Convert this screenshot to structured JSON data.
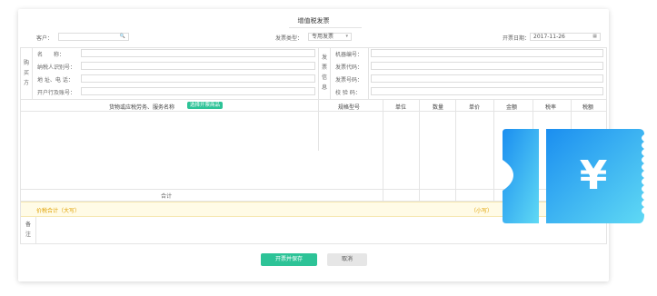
{
  "title": "增值税发票",
  "header": {
    "customer_label": "客户：",
    "customer_value": "",
    "invoice_type_label": "发票类型：",
    "invoice_type_value": "专用发票",
    "date_label": "开票日期：",
    "date_value": "2017-11-26"
  },
  "buyer": {
    "section_label": [
      "购",
      "买",
      "方"
    ],
    "fields": [
      "名　　称：",
      "纳税人识别号：",
      "地 址、电 话：",
      "开户行及账号："
    ]
  },
  "invoice_info": {
    "section_label": [
      "发",
      "票",
      "信",
      "息"
    ],
    "fields": [
      "机器编号：",
      "发票代码：",
      "发票号码：",
      "校 验 码："
    ]
  },
  "table": {
    "headers": [
      "货物或应税劳务、服务名称",
      "规格型号",
      "单位",
      "数量",
      "单价",
      "金额",
      "税率",
      "税额"
    ],
    "select_goods_label": "选择开票商品",
    "subtotal_label": "合计"
  },
  "totals": {
    "uppercase_label": "价税合计（大写）",
    "lowercase_label": "（小写）"
  },
  "remark_label": [
    "备",
    "注"
  ],
  "buttons": {
    "save": "开票并保存",
    "cancel": "取消"
  },
  "colors": {
    "accent": "#2dc397",
    "yellow_row": "#fffbe6",
    "ticket_gradient_start": "#1b8ef0",
    "ticket_gradient_end": "#5fd9f4"
  },
  "icons": {
    "search": "search-icon",
    "dropdown": "chevron-down-icon",
    "calendar": "calendar-icon",
    "ticket": "yen-ticket-icon"
  }
}
